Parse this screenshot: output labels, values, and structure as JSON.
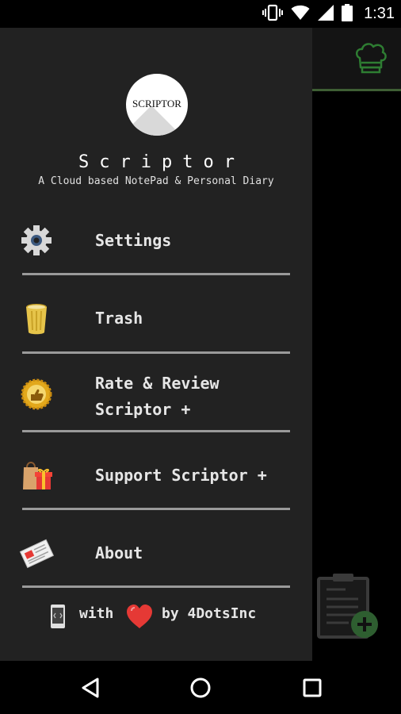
{
  "status_bar": {
    "time": "1:31",
    "icons": [
      "vibrate-icon",
      "wifi-icon",
      "signal-icon",
      "battery-icon"
    ]
  },
  "drawer": {
    "logo_text": "SCRIPTOR",
    "title": "Scriptor",
    "subtitle": "A Cloud based NotePad & Personal Diary",
    "menu": [
      {
        "label": "Settings",
        "icon": "gear-icon"
      },
      {
        "label": "Trash",
        "icon": "trash-icon"
      },
      {
        "label": "Rate & Review\nScriptor +",
        "icon": "thumbs-up-badge-icon"
      },
      {
        "label": "Support Scriptor +",
        "icon": "gift-shopping-bag-icon"
      },
      {
        "label": "About",
        "icon": "newspaper-icon"
      }
    ],
    "footer": {
      "with": "with",
      "by": "by 4DotsInc",
      "icons": [
        "phone-icon",
        "heart-icon"
      ]
    }
  },
  "background_app": {
    "toolbar_icon": "chef-hat-icon",
    "fab_icon": "clipboard-add-icon"
  },
  "colors": {
    "drawer_bg": "#222222",
    "accent_green": "#2e7d32",
    "divider": "#9a9a9a"
  },
  "nav_bar": {
    "buttons": [
      "back-icon",
      "home-icon",
      "recents-icon"
    ]
  }
}
